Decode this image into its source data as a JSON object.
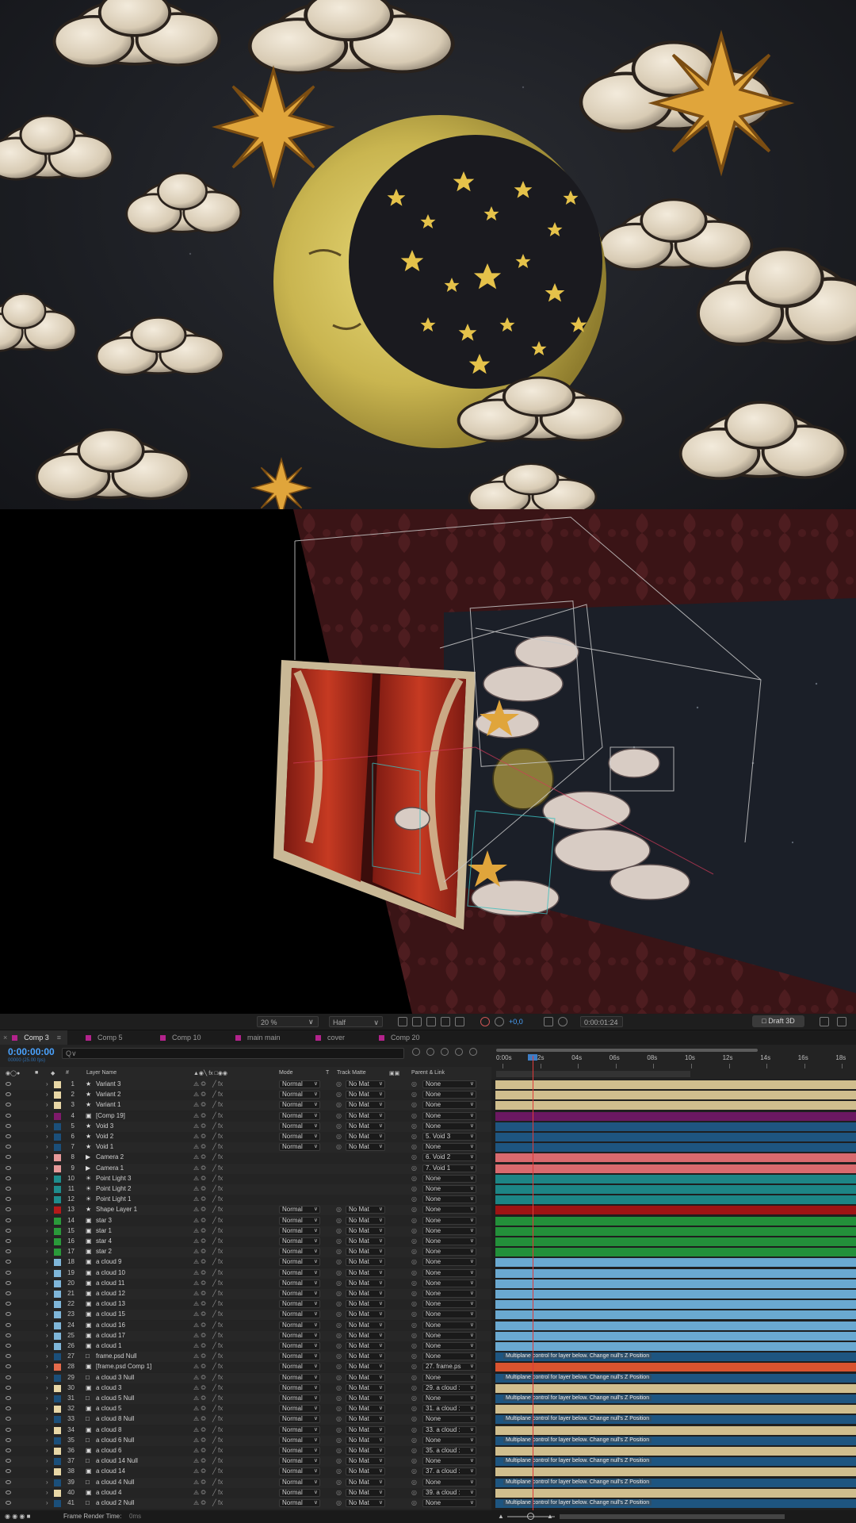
{
  "viewer_toolbar": {
    "zoom": "20 %",
    "resolution": "Half",
    "exposure": "+0,0",
    "timecode": "0:00:01:24",
    "renderer": "Draft 3D"
  },
  "tabs": [
    {
      "label": "Comp 3",
      "active": true
    },
    {
      "label": "Comp 5",
      "active": false
    },
    {
      "label": "Comp 10",
      "active": false
    },
    {
      "label": "main main",
      "active": false
    },
    {
      "label": "cover",
      "active": false
    },
    {
      "label": "Comp 20",
      "active": false
    }
  ],
  "timeline_controls": {
    "timecode": "0:00:00:00",
    "fps_label": "00000 (25.00 fps)",
    "search_placeholder": "Q∨"
  },
  "columns": {
    "number": "#",
    "layer_name": "Layer Name",
    "mode": "Mode",
    "t": "T",
    "track_matte": "Track Matte",
    "parent_link": "Parent & Link"
  },
  "ruler_ticks": [
    "0:00s",
    "02s",
    "04s",
    "06s",
    "08s",
    "10s",
    "12s",
    "14s",
    "16s",
    "18s"
  ],
  "layers": [
    {
      "num": "1",
      "name": "Variant 3",
      "icon": "star",
      "color": "#e8d7a6",
      "mode": "Normal",
      "matte": "No Mat",
      "parent": "None",
      "bar": "#d0be8e"
    },
    {
      "num": "2",
      "name": "Variant 2",
      "icon": "star",
      "color": "#e8d7a6",
      "mode": "Normal",
      "matte": "No Mat",
      "parent": "None",
      "bar": "#d0be8e"
    },
    {
      "num": "3",
      "name": "Variant 1",
      "icon": "star",
      "color": "#e8d7a6",
      "mode": "Normal",
      "matte": "No Mat",
      "parent": "None",
      "bar": "#d0be8e"
    },
    {
      "num": "4",
      "name": "[Comp 19]",
      "icon": "comp",
      "color": "#7e1a6b",
      "mode": "Normal",
      "matte": "No Mat",
      "parent": "None",
      "bar": "#6b1862"
    },
    {
      "num": "5",
      "name": "Void 3",
      "icon": "star",
      "color": "#1b4f7a",
      "mode": "Normal",
      "matte": "No Mat",
      "parent": "None",
      "bar": "#1e5580"
    },
    {
      "num": "6",
      "name": "Void 2",
      "icon": "star",
      "color": "#1b4f7a",
      "mode": "Normal",
      "matte": "No Mat",
      "parent": "5. Void 3",
      "bar": "#1e5580"
    },
    {
      "num": "7",
      "name": "Void 1",
      "icon": "star",
      "color": "#1b4f7a",
      "mode": "Normal",
      "matte": "No Mat",
      "parent": "None",
      "bar": "#1e5580"
    },
    {
      "num": "8",
      "name": "Camera 2",
      "icon": "camera",
      "color": "#e79a9a",
      "mode": "",
      "matte": "",
      "parent": "6. Void 2",
      "bar": "#d86a6e"
    },
    {
      "num": "9",
      "name": "Camera 1",
      "icon": "camera",
      "color": "#e79a9a",
      "mode": "",
      "matte": "",
      "parent": "7. Void 1",
      "bar": "#d86a6e"
    },
    {
      "num": "10",
      "name": "Point Light 3",
      "icon": "light",
      "color": "#1f8d8d",
      "mode": "",
      "matte": "",
      "parent": "None",
      "bar": "#1d8585"
    },
    {
      "num": "11",
      "name": "Point Light 2",
      "icon": "light",
      "color": "#1f8d8d",
      "mode": "",
      "matte": "",
      "parent": "None",
      "bar": "#1d8585"
    },
    {
      "num": "12",
      "name": "Point Light 1",
      "icon": "light",
      "color": "#1f8d8d",
      "mode": "",
      "matte": "",
      "parent": "None",
      "bar": "#1d8585"
    },
    {
      "num": "13",
      "name": "Shape Layer 1",
      "icon": "star",
      "color": "#b51a1a",
      "mode": "Normal",
      "matte": "No Mat",
      "parent": "None",
      "bar": "#9e1414"
    },
    {
      "num": "14",
      "name": "star 3",
      "icon": "comp",
      "color": "#2a9a3a",
      "mode": "Normal",
      "matte": "No Mat",
      "parent": "None",
      "bar": "#23903a"
    },
    {
      "num": "15",
      "name": "star 1",
      "icon": "comp",
      "color": "#2a9a3a",
      "mode": "Normal",
      "matte": "No Mat",
      "parent": "None",
      "bar": "#23903a"
    },
    {
      "num": "16",
      "name": "star 4",
      "icon": "comp",
      "color": "#2a9a3a",
      "mode": "Normal",
      "matte": "No Mat",
      "parent": "None",
      "bar": "#23903a"
    },
    {
      "num": "17",
      "name": "star 2",
      "icon": "comp",
      "color": "#2a9a3a",
      "mode": "Normal",
      "matte": "No Mat",
      "parent": "None",
      "bar": "#23903a"
    },
    {
      "num": "18",
      "name": "a cloud 9",
      "icon": "comp",
      "color": "#7fb6d9",
      "mode": "Normal",
      "matte": "No Mat",
      "parent": "None",
      "bar": "#6aa9d1"
    },
    {
      "num": "19",
      "name": "a cloud  10",
      "icon": "comp",
      "color": "#7fb6d9",
      "mode": "Normal",
      "matte": "No Mat",
      "parent": "None",
      "bar": "#6aa9d1"
    },
    {
      "num": "20",
      "name": "a cloud 11",
      "icon": "comp",
      "color": "#7fb6d9",
      "mode": "Normal",
      "matte": "No Mat",
      "parent": "None",
      "bar": "#6aa9d1"
    },
    {
      "num": "21",
      "name": "a cloud 12",
      "icon": "comp",
      "color": "#7fb6d9",
      "mode": "Normal",
      "matte": "No Mat",
      "parent": "None",
      "bar": "#6aa9d1"
    },
    {
      "num": "22",
      "name": "a cloud 13",
      "icon": "comp",
      "color": "#7fb6d9",
      "mode": "Normal",
      "matte": "No Mat",
      "parent": "None",
      "bar": "#6aa9d1"
    },
    {
      "num": "23",
      "name": "a cloud 15",
      "icon": "comp",
      "color": "#7fb6d9",
      "mode": "Normal",
      "matte": "No Mat",
      "parent": "None",
      "bar": "#6aa9d1"
    },
    {
      "num": "24",
      "name": "a cloud 16",
      "icon": "comp",
      "color": "#7fb6d9",
      "mode": "Normal",
      "matte": "No Mat",
      "parent": "None",
      "bar": "#6aa9d1"
    },
    {
      "num": "25",
      "name": "a cloud 17",
      "icon": "comp",
      "color": "#7fb6d9",
      "mode": "Normal",
      "matte": "No Mat",
      "parent": "None",
      "bar": "#6aa9d1"
    },
    {
      "num": "26",
      "name": "a cloud 1",
      "icon": "comp",
      "color": "#7fb6d9",
      "mode": "Normal",
      "matte": "No Mat",
      "parent": "None",
      "bar": "#6aa9d1"
    },
    {
      "num": "27",
      "name": "frame.psd Null",
      "icon": "null",
      "color": "#1b4f7a",
      "mode": "Normal",
      "matte": "No Mat",
      "parent": "None",
      "bar": "#1e5580",
      "label": "Multiplane control for layer below. Change null's Z Position"
    },
    {
      "num": "28",
      "name": "[frame.psd Comp 1]",
      "icon": "comp",
      "color": "#e56b4b",
      "mode": "Normal",
      "matte": "No Mat",
      "parent": "27. frame.ps",
      "bar": "#d9532f"
    },
    {
      "num": "29",
      "name": "a cloud 3 Null",
      "icon": "null",
      "color": "#1b4f7a",
      "mode": "Normal",
      "matte": "No Mat",
      "parent": "None",
      "bar": "#1e5580",
      "label": "Multiplane control for layer below. Change null's Z Position"
    },
    {
      "num": "30",
      "name": "a cloud 3",
      "icon": "comp",
      "color": "#e8d7a6",
      "mode": "Normal",
      "matte": "No Mat",
      "parent": "29. a cloud :",
      "bar": "#d0be8e"
    },
    {
      "num": "31",
      "name": "a cloud 5 Null",
      "icon": "null",
      "color": "#1b4f7a",
      "mode": "Normal",
      "matte": "No Mat",
      "parent": "None",
      "bar": "#1e5580",
      "label": "Multiplane control for layer below. Change null's Z Position"
    },
    {
      "num": "32",
      "name": "a cloud 5",
      "icon": "comp",
      "color": "#e8d7a6",
      "mode": "Normal",
      "matte": "No Mat",
      "parent": "31. a cloud :",
      "bar": "#d0be8e"
    },
    {
      "num": "33",
      "name": "a cloud 8 Null",
      "icon": "null",
      "color": "#1b4f7a",
      "mode": "Normal",
      "matte": "No Mat",
      "parent": "None",
      "bar": "#1e5580",
      "label": "Multiplane control for layer below. Change null's Z Position"
    },
    {
      "num": "34",
      "name": "a cloud 8",
      "icon": "comp",
      "color": "#e8d7a6",
      "mode": "Normal",
      "matte": "No Mat",
      "parent": "33. a cloud :",
      "bar": "#d0be8e"
    },
    {
      "num": "35",
      "name": "a cloud 6 Null",
      "icon": "null",
      "color": "#1b4f7a",
      "mode": "Normal",
      "matte": "No Mat",
      "parent": "None",
      "bar": "#1e5580",
      "label": "Multiplane control for layer below. Change null's Z Position"
    },
    {
      "num": "36",
      "name": "a cloud 6",
      "icon": "comp",
      "color": "#e8d7a6",
      "mode": "Normal",
      "matte": "No Mat",
      "parent": "35. a cloud :",
      "bar": "#d0be8e"
    },
    {
      "num": "37",
      "name": "a cloud 14 Null",
      "icon": "null",
      "color": "#1b4f7a",
      "mode": "Normal",
      "matte": "No Mat",
      "parent": "None",
      "bar": "#1e5580",
      "label": "Multiplane control for layer below. Change null's Z Position"
    },
    {
      "num": "38",
      "name": "a cloud 14",
      "icon": "comp",
      "color": "#e8d7a6",
      "mode": "Normal",
      "matte": "No Mat",
      "parent": "37. a cloud :",
      "bar": "#d0be8e"
    },
    {
      "num": "39",
      "name": "a cloud 4 Null",
      "icon": "null",
      "color": "#1b4f7a",
      "mode": "Normal",
      "matte": "No Mat",
      "parent": "None",
      "bar": "#1e5580",
      "label": "Multiplane control for layer below. Change null's Z Position"
    },
    {
      "num": "40",
      "name": "a cloud 4",
      "icon": "comp",
      "color": "#e8d7a6",
      "mode": "Normal",
      "matte": "No Mat",
      "parent": "39. a cloud :",
      "bar": "#d0be8e"
    },
    {
      "num": "41",
      "name": "a cloud 2 Null",
      "icon": "null",
      "color": "#1b4f7a",
      "mode": "Normal",
      "matte": "No Mat",
      "parent": "None",
      "bar": "#1e5580",
      "label": "Multiplane control for layer below. Change null's Z Position"
    }
  ],
  "status_bar": {
    "frame_render_label": "Frame Render Time:",
    "frame_render_value": "0ms"
  }
}
